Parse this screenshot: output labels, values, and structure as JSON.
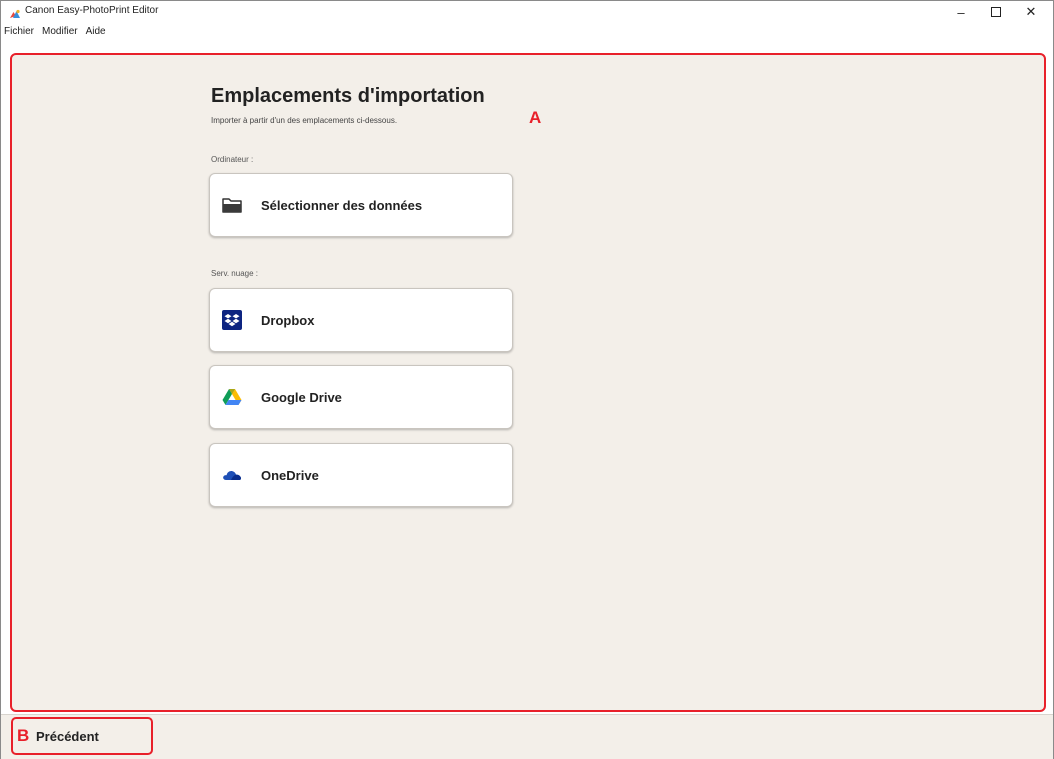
{
  "window": {
    "title": "Canon Easy-PhotoPrint Editor",
    "minimize_glyph": "–",
    "close_glyph": "✕"
  },
  "menu": [
    "Fichier",
    "Modifier",
    "Aide"
  ],
  "main": {
    "title": "Emplacements d'importation",
    "subtitle": "Importer à partir d'un des emplacements ci-dessous.",
    "marker": "A",
    "computer_label": "Ordinateur :",
    "computer_sources": [
      {
        "label": "Sélectionner des données",
        "icon": "folder-icon"
      }
    ],
    "cloud_label": "Serv. nuage :",
    "cloud_sources": [
      {
        "label": "Dropbox",
        "icon": "dropbox-icon"
      },
      {
        "label": "Google Drive",
        "icon": "google-drive-icon"
      },
      {
        "label": "OneDrive",
        "icon": "onedrive-icon"
      }
    ]
  },
  "footer": {
    "marker": "B",
    "back_label": "Précédent"
  },
  "colors": {
    "annotation_red": "#e8202a",
    "content_background": "#f3efe9",
    "dropbox_blue": "#0d2481",
    "onedrive_blue": "#1e4fb6"
  }
}
